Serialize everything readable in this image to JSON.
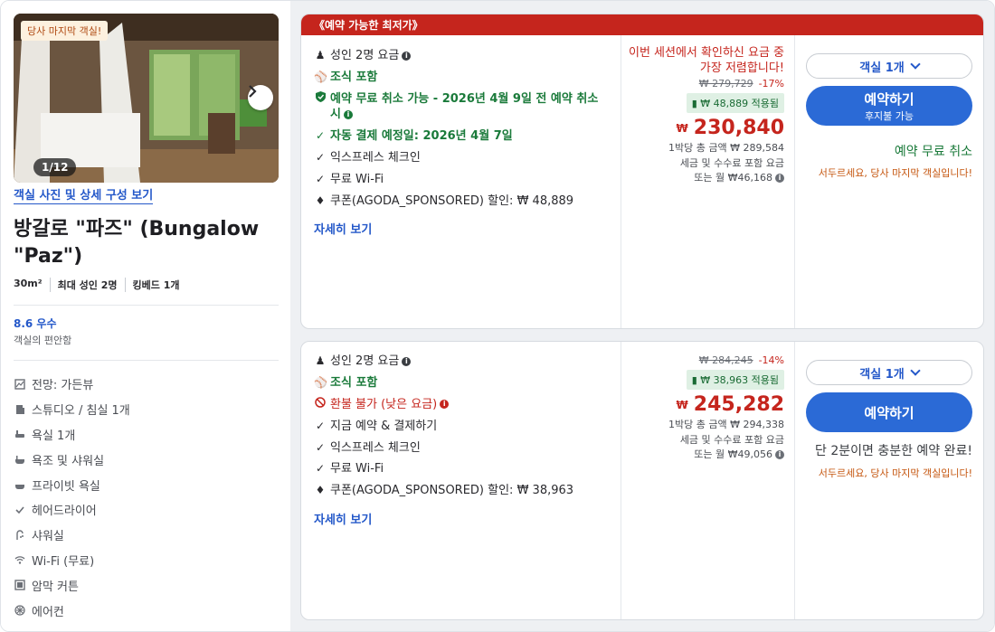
{
  "room": {
    "photo_tag": "당사 마지막 객실!",
    "photo_count": "1/12",
    "photo_link": "객실 사진 및 상세 구성 보기",
    "title_line1": "방갈로 \"파즈\" (Bungalow",
    "title_line2": "\"Paz\")",
    "specs": [
      "30m²",
      "최대 성인 2명",
      "킹베드 1개"
    ],
    "score": "8.6 우수",
    "score_sub": "객실의 편안함",
    "amenities": [
      {
        "icon": "view-icon",
        "label": "전망: 가든뷰"
      },
      {
        "icon": "studio-icon",
        "label": "스튜디오 / 침실 1개"
      },
      {
        "icon": "bathroom-icon",
        "label": "욕실 1개"
      },
      {
        "icon": "bathtub-icon",
        "label": "욕조 및 샤워실"
      },
      {
        "icon": "private-bath-icon",
        "label": "프라이빗 욕실"
      },
      {
        "icon": "check-icon",
        "label": "헤어드라이어"
      },
      {
        "icon": "shower-icon",
        "label": "샤워실"
      },
      {
        "icon": "wifi-icon",
        "label": "Wi-Fi (무료)"
      },
      {
        "icon": "curtain-icon",
        "label": "암막 커튼"
      },
      {
        "icon": "ac-icon",
        "label": "에어컨"
      }
    ]
  },
  "offer1": {
    "banner": "《예약 가능한 최저가》",
    "features": [
      {
        "icon": "person-icon",
        "text": "성인 2명 요금",
        "style": "normal",
        "info": true
      },
      {
        "icon": "utensils-icon",
        "text": "조식 포함",
        "style": "green"
      },
      {
        "icon": "shield-icon",
        "text": "예약 무료 취소 가능 - 2026년 4월 9일 전 예약 취소 시",
        "style": "green",
        "info": true
      },
      {
        "icon": "check-icon",
        "text": "자동 결제 예정일: 2026년 4월 7일",
        "style": "green"
      },
      {
        "icon": "check-icon",
        "text": "익스프레스 체크인",
        "style": "normal"
      },
      {
        "icon": "check-icon",
        "text": "무료 Wi-Fi",
        "style": "normal"
      },
      {
        "icon": "tag-icon",
        "text": "쿠폰(AGODA_SPONSORED) 할인: ₩ 48,889",
        "style": "normal"
      }
    ],
    "more": "자세히 보기",
    "alert": "이번 세션에서 확인하신 요금 중 가장 저렴합니다!",
    "strike_price": "₩ 279,729",
    "discount_pct": "-17%",
    "applied": "₩ 48,889 적용됨",
    "currency": "₩",
    "price": "230,840",
    "sub1": "1박당 총 금액 ₩ 289,584",
    "sub2": "세금 및 수수료 포함 요금",
    "sub3": "또는 월 ₩46,168",
    "room_select": "객실 1개",
    "book_label": "예약하기",
    "book_sub": "후지불 가능",
    "free_cancel": "예약 무료 취소",
    "hurry": "서두르세요, 당사 마지막 객실입니다!"
  },
  "offer2": {
    "features": [
      {
        "icon": "person-icon",
        "text": "성인 2명 요금",
        "style": "normal",
        "info": true
      },
      {
        "icon": "utensils-icon",
        "text": "조식 포함",
        "style": "green"
      },
      {
        "icon": "ban-icon",
        "text": "환불 불가 (낮은 요금)",
        "style": "red",
        "info": true
      },
      {
        "icon": "check-icon",
        "text": "지금 예약 & 결제하기",
        "style": "normal"
      },
      {
        "icon": "check-icon",
        "text": "익스프레스 체크인",
        "style": "normal"
      },
      {
        "icon": "check-icon",
        "text": "무료 Wi-Fi",
        "style": "normal"
      },
      {
        "icon": "tag-icon",
        "text": "쿠폰(AGODA_SPONSORED) 할인: ₩ 38,963",
        "style": "normal"
      }
    ],
    "more": "자세히 보기",
    "strike_price": "₩ 284,245",
    "discount_pct": "-14%",
    "applied": "₩ 38,963 적용됨",
    "currency": "₩",
    "price": "245,282",
    "sub1": "1박당 총 금액 ₩ 294,338",
    "sub2": "세금 및 수수료 포함 요금",
    "sub3": "또는 월 ₩49,056",
    "room_select": "객실 1개",
    "book_label": "예약하기",
    "enough": "단 2분이면 충분한 예약 완료!",
    "hurry": "서두르세요, 당사 마지막 객실입니다!"
  }
}
